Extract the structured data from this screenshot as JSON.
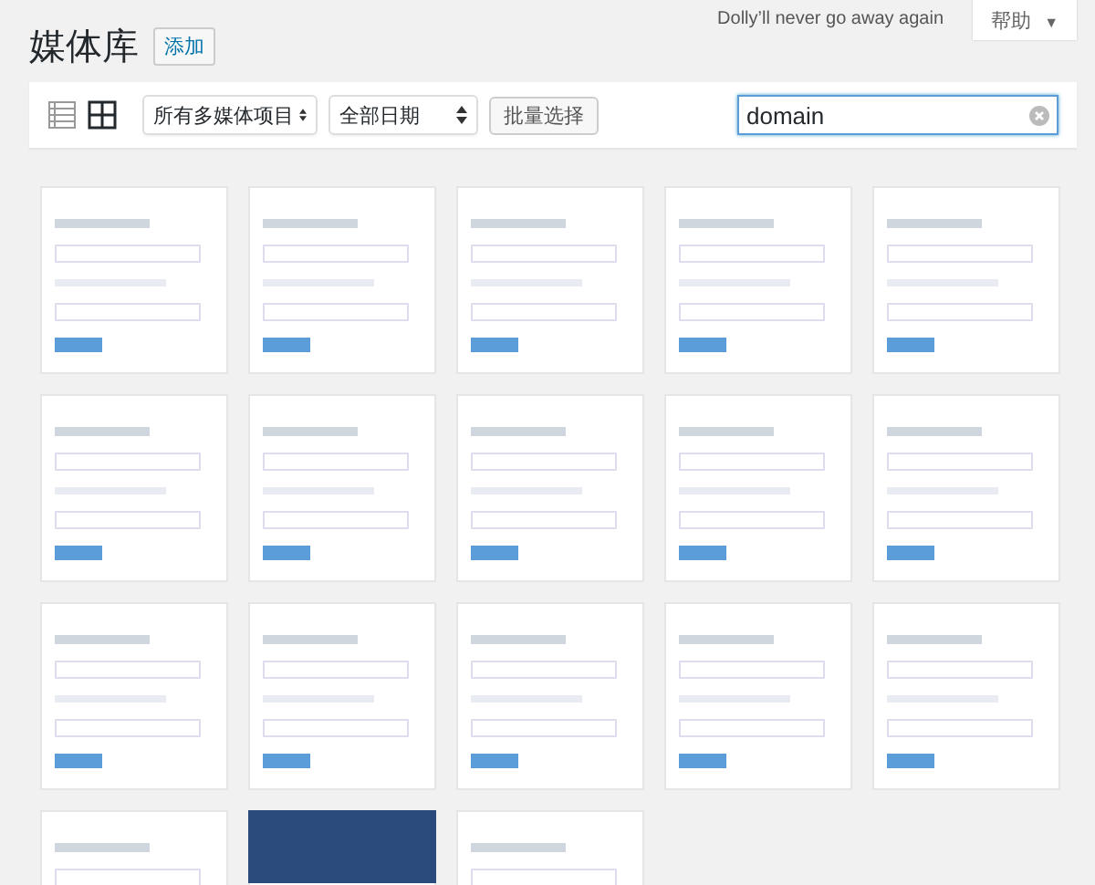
{
  "header": {
    "title": "媒体库",
    "add_button": "添加",
    "dolly": "Dolly’ll never go away again",
    "help_button": "帮助",
    "help_caret": "▼"
  },
  "toolbar": {
    "views": [
      {
        "kind": "list",
        "selected": false
      },
      {
        "kind": "grid",
        "selected": true
      }
    ],
    "type_filter": "所有多媒体项目",
    "date_filter": "全部日期",
    "bulk_button": "批量选择",
    "search": {
      "value": "domain"
    }
  },
  "thumbnails": [
    {
      "kind": "light"
    },
    {
      "kind": "light"
    },
    {
      "kind": "light"
    },
    {
      "kind": "light"
    },
    {
      "kind": "light"
    },
    {
      "kind": "light"
    },
    {
      "kind": "light"
    },
    {
      "kind": "light"
    },
    {
      "kind": "light"
    },
    {
      "kind": "light"
    },
    {
      "kind": "light"
    },
    {
      "kind": "light"
    },
    {
      "kind": "light"
    },
    {
      "kind": "light"
    },
    {
      "kind": "light"
    },
    {
      "kind": "light"
    },
    {
      "kind": "dark"
    },
    {
      "kind": "light"
    }
  ]
}
